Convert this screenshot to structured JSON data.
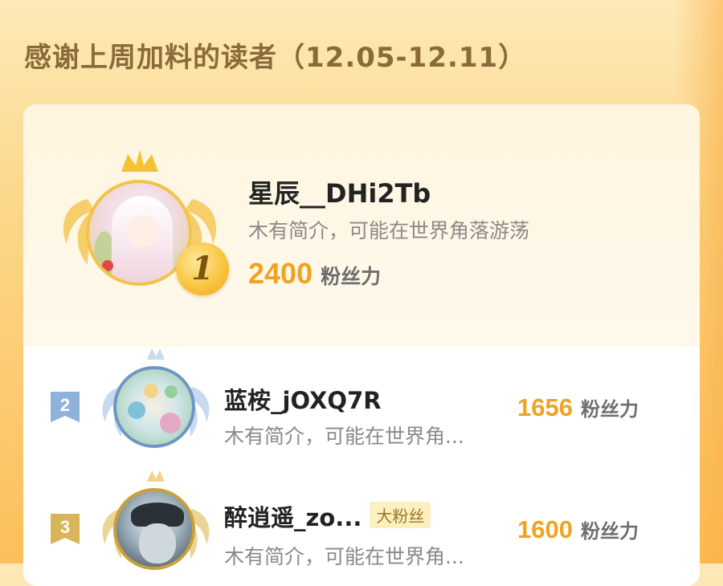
{
  "heading": "感谢上周加料的读者（12.05-12.11）",
  "colors": {
    "background": "#fbd88b",
    "accent": "#f0a220",
    "rank_1": "#f8c23b",
    "rank_2": "#8fb2dd",
    "rank_3": "#d8b558"
  },
  "leaderboard": [
    {
      "rank": "1",
      "name": "星辰__DHi2Tb",
      "intro": "木有简介，可能在世界角落游荡",
      "score": "2400",
      "unit": "粉丝力",
      "tag": ""
    },
    {
      "rank": "2",
      "name": "蓝桉_jOXQ7R",
      "intro": "木有简介，可能在世界角...",
      "score": "1656",
      "unit": "粉丝力",
      "tag": ""
    },
    {
      "rank": "3",
      "name": "醉逍遥_zo...",
      "intro": "木有简介，可能在世界角...",
      "score": "1600",
      "unit": "粉丝力",
      "tag": "大粉丝"
    }
  ]
}
